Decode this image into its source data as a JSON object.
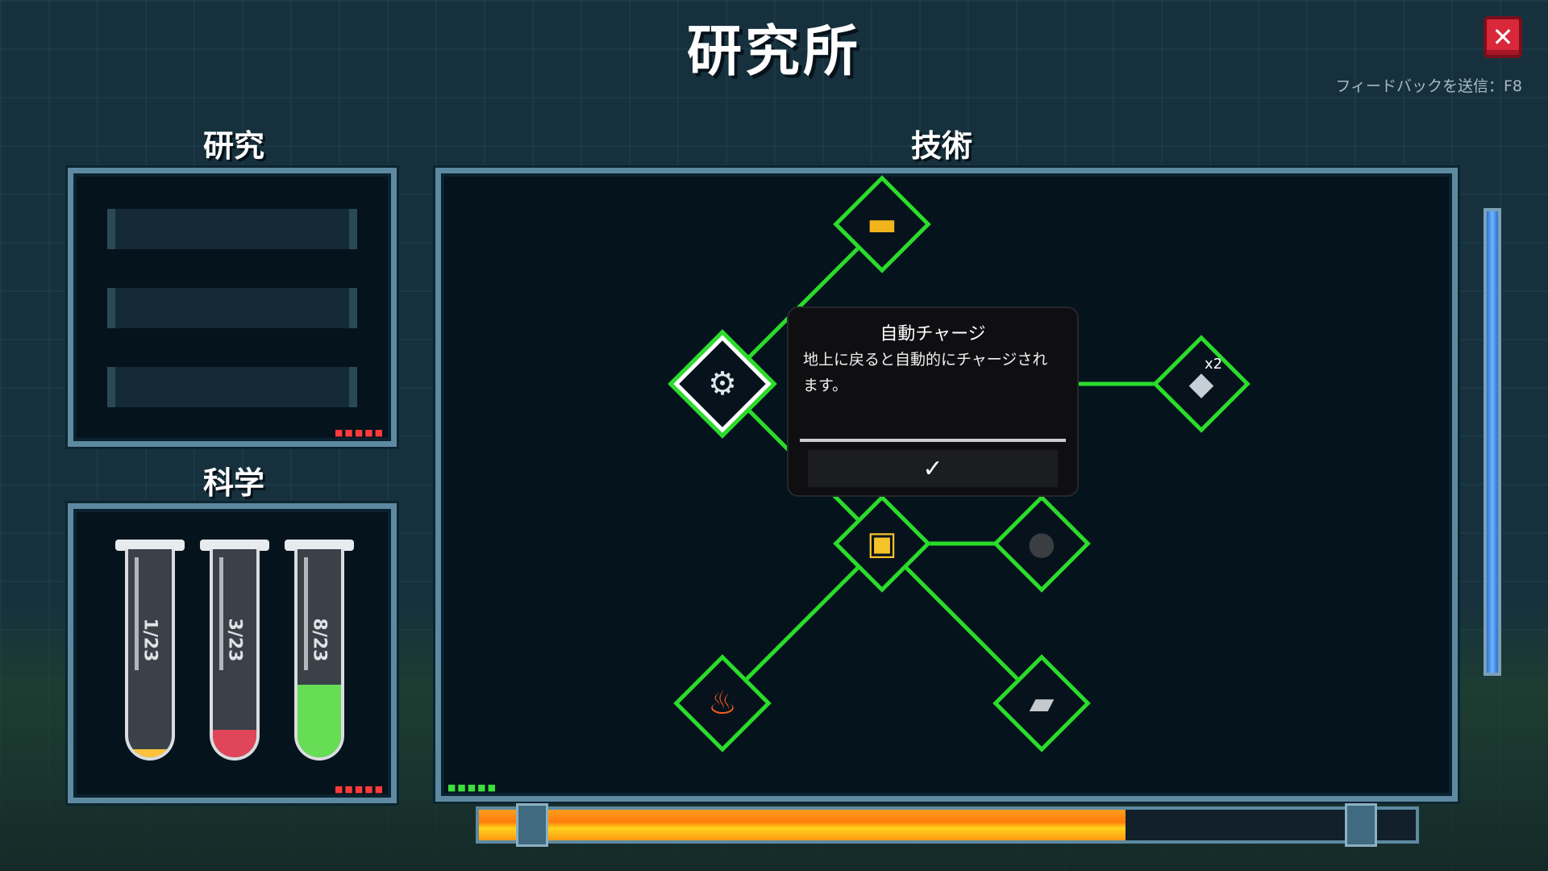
{
  "window": {
    "title": "研究所",
    "close_icon": "✕",
    "feedback": "フィードバックを送信：F8"
  },
  "research": {
    "title": "研究"
  },
  "science": {
    "title": "科学",
    "tubes": [
      {
        "label": "1/23",
        "color": "#ffc23a",
        "level": 0.04
      },
      {
        "label": "3/23",
        "color": "#e0465a",
        "level": 0.13
      },
      {
        "label": "8/23",
        "color": "#66dd55",
        "level": 0.35
      }
    ]
  },
  "tech": {
    "title": "技術",
    "nodes": [
      {
        "name": "node-gold-ingot",
        "icon": "gold-bar-icon",
        "glyph": "▬"
      },
      {
        "name": "node-auto-charge",
        "icon": "battery-gear-icon",
        "glyph": "⚙"
      },
      {
        "name": "node-ore-x2",
        "icon": "silver-ore-x2-icon",
        "glyph": "◆",
        "badge": "x2"
      },
      {
        "name": "node-robot-cart",
        "icon": "robot-cart-icon",
        "glyph": "▣"
      },
      {
        "name": "node-coal-drop",
        "icon": "coal-drop-icon",
        "glyph": "●"
      },
      {
        "name": "node-burning-coal",
        "icon": "burning-coal-icon",
        "glyph": "🔥"
      },
      {
        "name": "node-iron-upgrade",
        "icon": "iron-bar-upgrade-icon",
        "glyph": "▰"
      }
    ],
    "tooltip": {
      "title": "自動チャージ",
      "description": "地上に戻ると自動的にチャージされます。",
      "confirm": "✓"
    }
  },
  "progress": {
    "fraction": 0.69
  },
  "colors": {
    "node_border": "#2bdc2b",
    "panel_border": "#5d8aa0",
    "close_button": "#d8283a"
  }
}
